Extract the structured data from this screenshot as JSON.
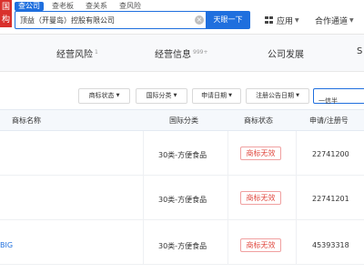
{
  "header": {
    "logo_text": "国\n构",
    "tabs": [
      "查公司",
      "查老板",
      "查关系",
      "查风险"
    ],
    "search": {
      "value": "顶益（开曼岛）控股有限公司",
      "placeholder": ""
    },
    "search_button": "天眼一下",
    "app_menu": "应用",
    "partner_menu": "合作通道"
  },
  "section_nav": {
    "tabs": [
      {
        "label": "经营风险",
        "count": "1"
      },
      {
        "label": "经营信息",
        "count": "999+"
      },
      {
        "label": "公司发展",
        "count": ""
      },
      {
        "label": "S",
        "count": ""
      }
    ]
  },
  "filters": {
    "buttons": [
      "商标状态",
      "国际分类",
      "申请日期",
      "注册公告日期"
    ],
    "search_value": "一信半"
  },
  "table": {
    "headers": [
      "商标名称",
      "国际分类",
      "商标状态",
      "申请/注册号"
    ],
    "rows": [
      {
        "name": "",
        "category": "30类-方便食品",
        "status": "商标无效",
        "reg_no": "22741200"
      },
      {
        "name": "",
        "category": "30类-方便食品",
        "status": "商标无效",
        "reg_no": "22741201"
      },
      {
        "name": "BIG",
        "category": "30类-方便食品",
        "status": "商标无效",
        "reg_no": "45393318"
      }
    ]
  }
}
